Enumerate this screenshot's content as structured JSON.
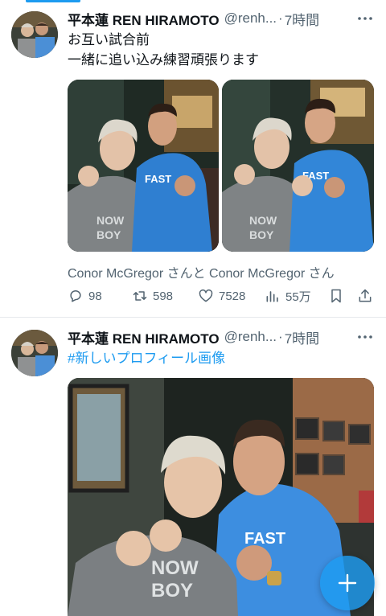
{
  "colors": {
    "accent": "#1d9bf0",
    "muted": "#536471",
    "text": "#0f1419"
  },
  "tweets": [
    {
      "author_name": "平本蓮 REN HIRAMOTO",
      "handle": "@renh...",
      "separator": "·",
      "time": "7時間",
      "text_lines": [
        "お互い試合前",
        "一緒に追い込み練習頑張ります"
      ],
      "tagged": "Conor McGregor さんと Conor McGregor さん",
      "stats": {
        "replies": "98",
        "retweets": "598",
        "likes": "7528",
        "views": "55万"
      }
    },
    {
      "author_name": "平本蓮 REN HIRAMOTO",
      "handle": "@renh...",
      "separator": "·",
      "time": "7時間",
      "hashtag": "#新しいプロフィール画像"
    }
  ],
  "icons": [
    "more-icon",
    "reply-icon",
    "retweet-icon",
    "like-icon",
    "views-icon",
    "bookmark-icon",
    "share-icon",
    "compose-plus-icon"
  ]
}
